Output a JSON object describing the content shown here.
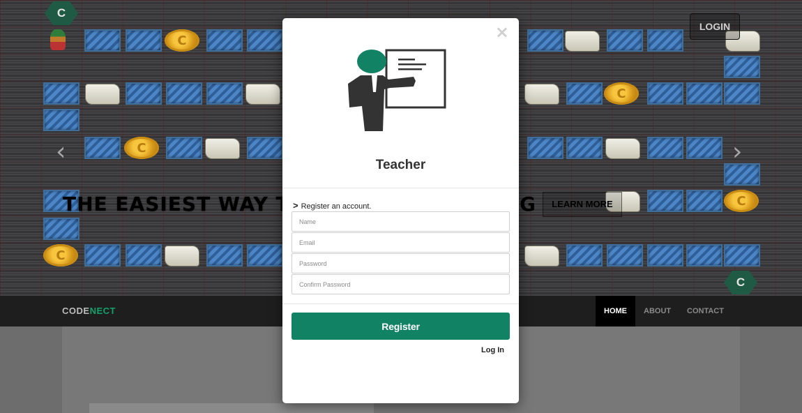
{
  "hero": {
    "headline": "THE EASIEST WAY TO",
    "headline_tail": "G",
    "learn_more": "LEARN MORE",
    "login_button": "LOGIN",
    "prev_arrow": "‹",
    "next_arrow": "›"
  },
  "navbar": {
    "brand_part1": "CODE",
    "brand_part2": "NECT",
    "items": [
      {
        "label": "HOME",
        "active": true
      },
      {
        "label": "ABOUT",
        "active": false
      },
      {
        "label": "CONTACT",
        "active": false
      }
    ]
  },
  "modal": {
    "close_symbol": "×",
    "title": "Teacher",
    "hint_icon": ">",
    "hint_text": "Register an account.",
    "fields": {
      "name_placeholder": "Name",
      "email_placeholder": "Email",
      "password_placeholder": "Password",
      "confirm_placeholder": "Confirm Password"
    },
    "register_button": "Register",
    "login_link": "Log In"
  },
  "colors": {
    "accent_green": "#128265",
    "brand_green": "#12a06b",
    "navbar_bg": "#1e1e1e"
  },
  "icons": {
    "illustration": "teacher-at-board-icon",
    "close": "close-icon",
    "chevron": "chevron-right-icon",
    "brand_badge": "hex-c-logo-icon"
  }
}
